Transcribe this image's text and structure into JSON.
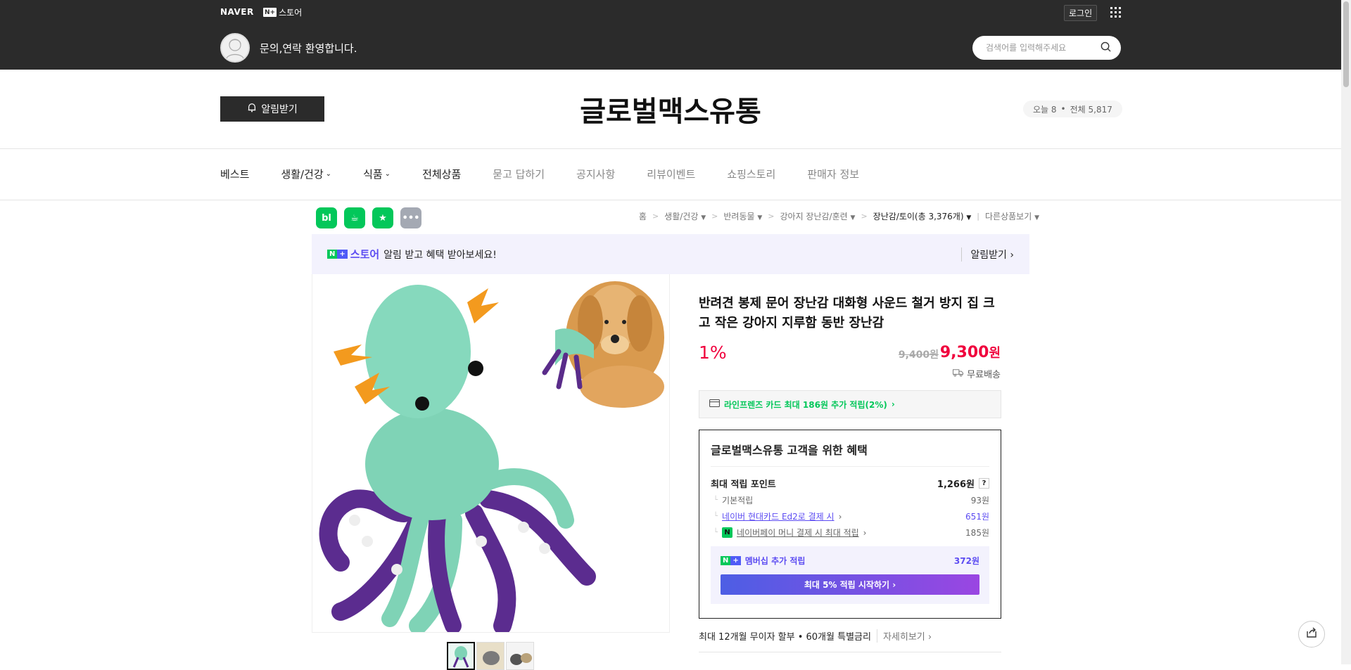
{
  "top": {
    "naver_logo": "NAVER",
    "store_logo_badge": "N+",
    "store_logo_text": "스토어",
    "login": "로그인",
    "welcome": "문의,연락 환영합니다.",
    "search_placeholder": "검색어를 입력해주세요"
  },
  "header": {
    "alarm_button": "알림받기",
    "store_name": "글로벌맥스유통",
    "visit_today_label": "오늘 8",
    "visit_total_label": "전체 5,817"
  },
  "nav": [
    {
      "label": "베스트",
      "dropdown": false,
      "dim": false
    },
    {
      "label": "생활/건강",
      "dropdown": true,
      "dim": false
    },
    {
      "label": "식품",
      "dropdown": true,
      "dim": false
    },
    {
      "label": "전체상품",
      "dropdown": false,
      "dim": false
    },
    {
      "label": "묻고 답하기",
      "dropdown": false,
      "dim": true
    },
    {
      "label": "공지사항",
      "dropdown": false,
      "dim": true
    },
    {
      "label": "리뷰이벤트",
      "dropdown": false,
      "dim": true
    },
    {
      "label": "쇼핑스토리",
      "dropdown": false,
      "dim": true
    },
    {
      "label": "판매자 정보",
      "dropdown": false,
      "dim": true
    }
  ],
  "share_icons": [
    {
      "name": "blog-share-icon",
      "glyph": "bl",
      "color": "#03c75a"
    },
    {
      "name": "cafe-share-icon",
      "glyph": "☕",
      "color": "#03c75a"
    },
    {
      "name": "bookmark-share-icon",
      "glyph": "★",
      "color": "#03c75a"
    },
    {
      "name": "more-share-icon",
      "glyph": "•••",
      "color": "#a4a9b3"
    }
  ],
  "breadcrumb": {
    "home": "홈",
    "c1": "생활/건강",
    "c2": "반려동물",
    "c3": "강아지 장난감/훈련",
    "c4": "장난감/토이",
    "c4_count": "(총 3,376개)",
    "other": "다른상품보기"
  },
  "notice": {
    "badge_n": "N",
    "badge_plus": "+",
    "store_word": "스토어",
    "message": "알림 받고 혜택 받아보세요!",
    "link": "알림받기"
  },
  "product": {
    "title": "반려견 봉제 문어 장난감 대화형 사운드 철거 방지 집 크고 작은 강아지 지루함 동반 장난감",
    "discount": "1%",
    "original_price": "9,400원",
    "final_price_num": "9,300",
    "final_price_unit": "원",
    "shipping": "무료배송",
    "card_promo": "라인프렌즈 카드 최대 186원 추가 적립(2%)"
  },
  "benefit": {
    "title": "글로벌맥스유통 고객을 위한 혜택",
    "max_points_label": "최대 적립 포인트",
    "max_points_value": "1,266원",
    "basic_label": "기본적립",
    "basic_value": "93원",
    "card_label": "네이버 현대카드 Ed2로 결제 시",
    "card_value": "651원",
    "npay_label": "네이버페이 머니 결제 시 최대 적립",
    "npay_value": "185원",
    "member_label": "멤버십 추가 적립",
    "member_value": "372원",
    "member_button": "최대 5% 적립 시작하기"
  },
  "installment": {
    "text": "최대 12개월 무이자 할부 • 60개월 특별금리",
    "more": "자세히보기"
  },
  "colors": {
    "naver_green": "#03c75a",
    "price_red": "#f0013d",
    "purple": "#5c4cf2",
    "dark_bar": "#2b2b2b"
  }
}
